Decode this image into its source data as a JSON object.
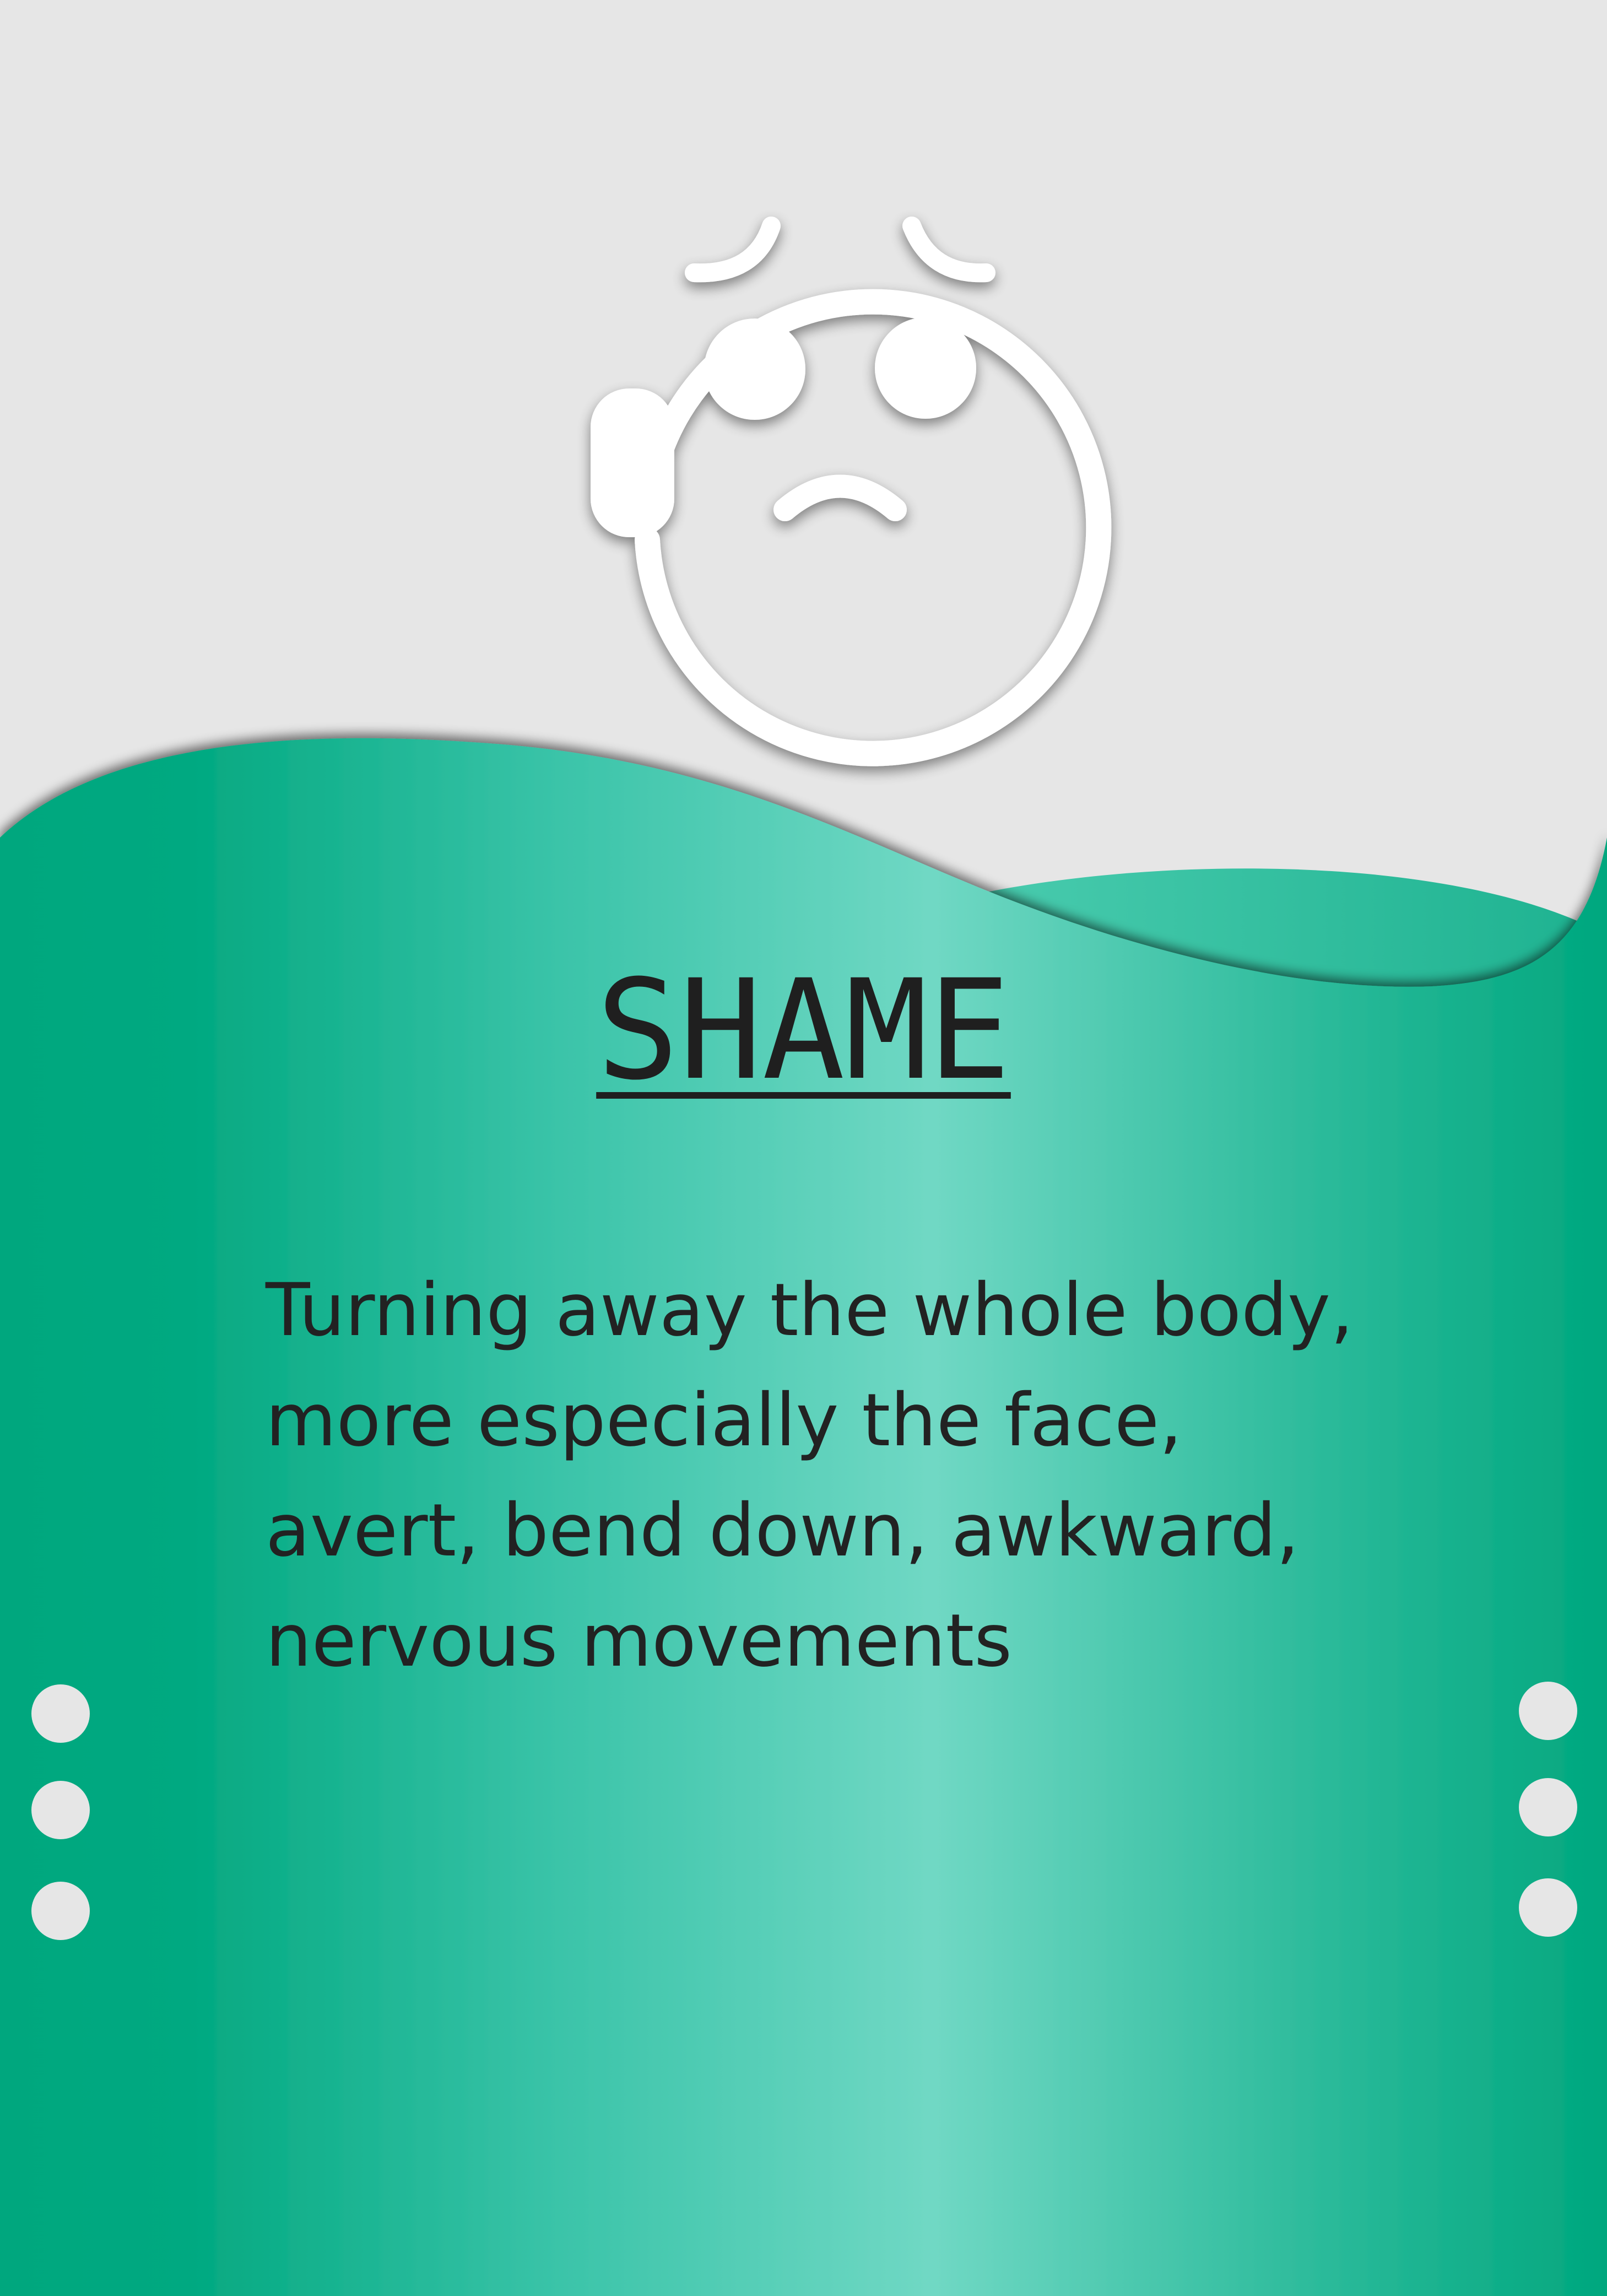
{
  "card": {
    "title": "SHAME",
    "description_lines": [
      "Turning away the whole body,",
      "more especially the face,",
      "avert, bend down, awkward,",
      "nervous movements"
    ]
  },
  "icon": "anxious-face-with-headset-icon",
  "colors": {
    "background_top": "#e6e6e6",
    "green_dark": "#00a77e",
    "green_light": "#70d8c4",
    "text": "#222222",
    "icon": "#ffffff",
    "dots": "#e6e6e6"
  }
}
